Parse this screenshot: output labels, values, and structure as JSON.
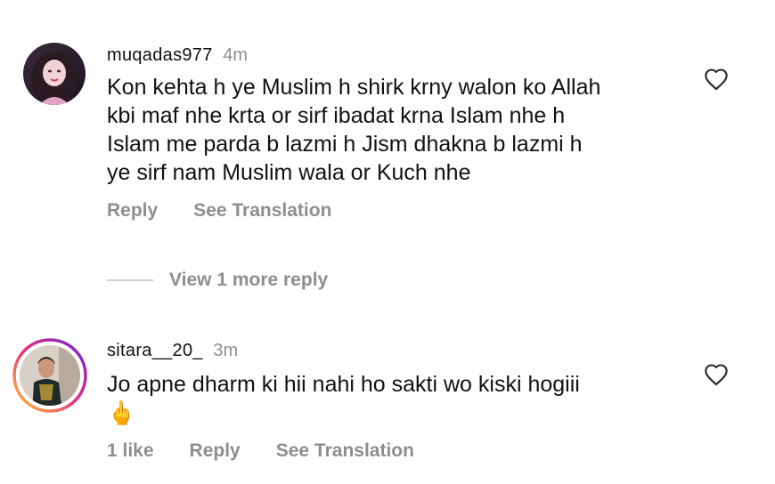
{
  "comments": [
    {
      "username": "muqadas977",
      "time": "4m",
      "lines": [
        "Kon kehta h ye Muslim h shirk krny walon ko Allah",
        "kbi maf nhe krta or sirf ibadat krna Islam nhe h",
        "Islam me parda b lazmi h Jism dhakna b lazmi h",
        "ye sirf nam Muslim wala or Kuch nhe"
      ],
      "reply_label": "Reply",
      "translate_label": "See Translation",
      "avatar_icon": "user-avatar",
      "like_icon": "heart-outline-icon"
    },
    {
      "username": "sitara__20_",
      "time": "3m",
      "lines": [
        "Jo apne dharm ki hii nahi ho sakti wo kiski hogiii"
      ],
      "emoji": "🖕",
      "likes_label": "1 like",
      "reply_label": "Reply",
      "translate_label": "See Translation",
      "avatar_icon": "user-avatar-story-ring",
      "like_icon": "heart-outline-icon"
    }
  ],
  "view_more_replies": "View 1 more reply",
  "colors": {
    "text": "#111111",
    "muted": "#8e8e8e",
    "story_ring_start": "#f9ce34",
    "story_ring_mid": "#ee2a7b",
    "story_ring_end": "#6228d7"
  }
}
